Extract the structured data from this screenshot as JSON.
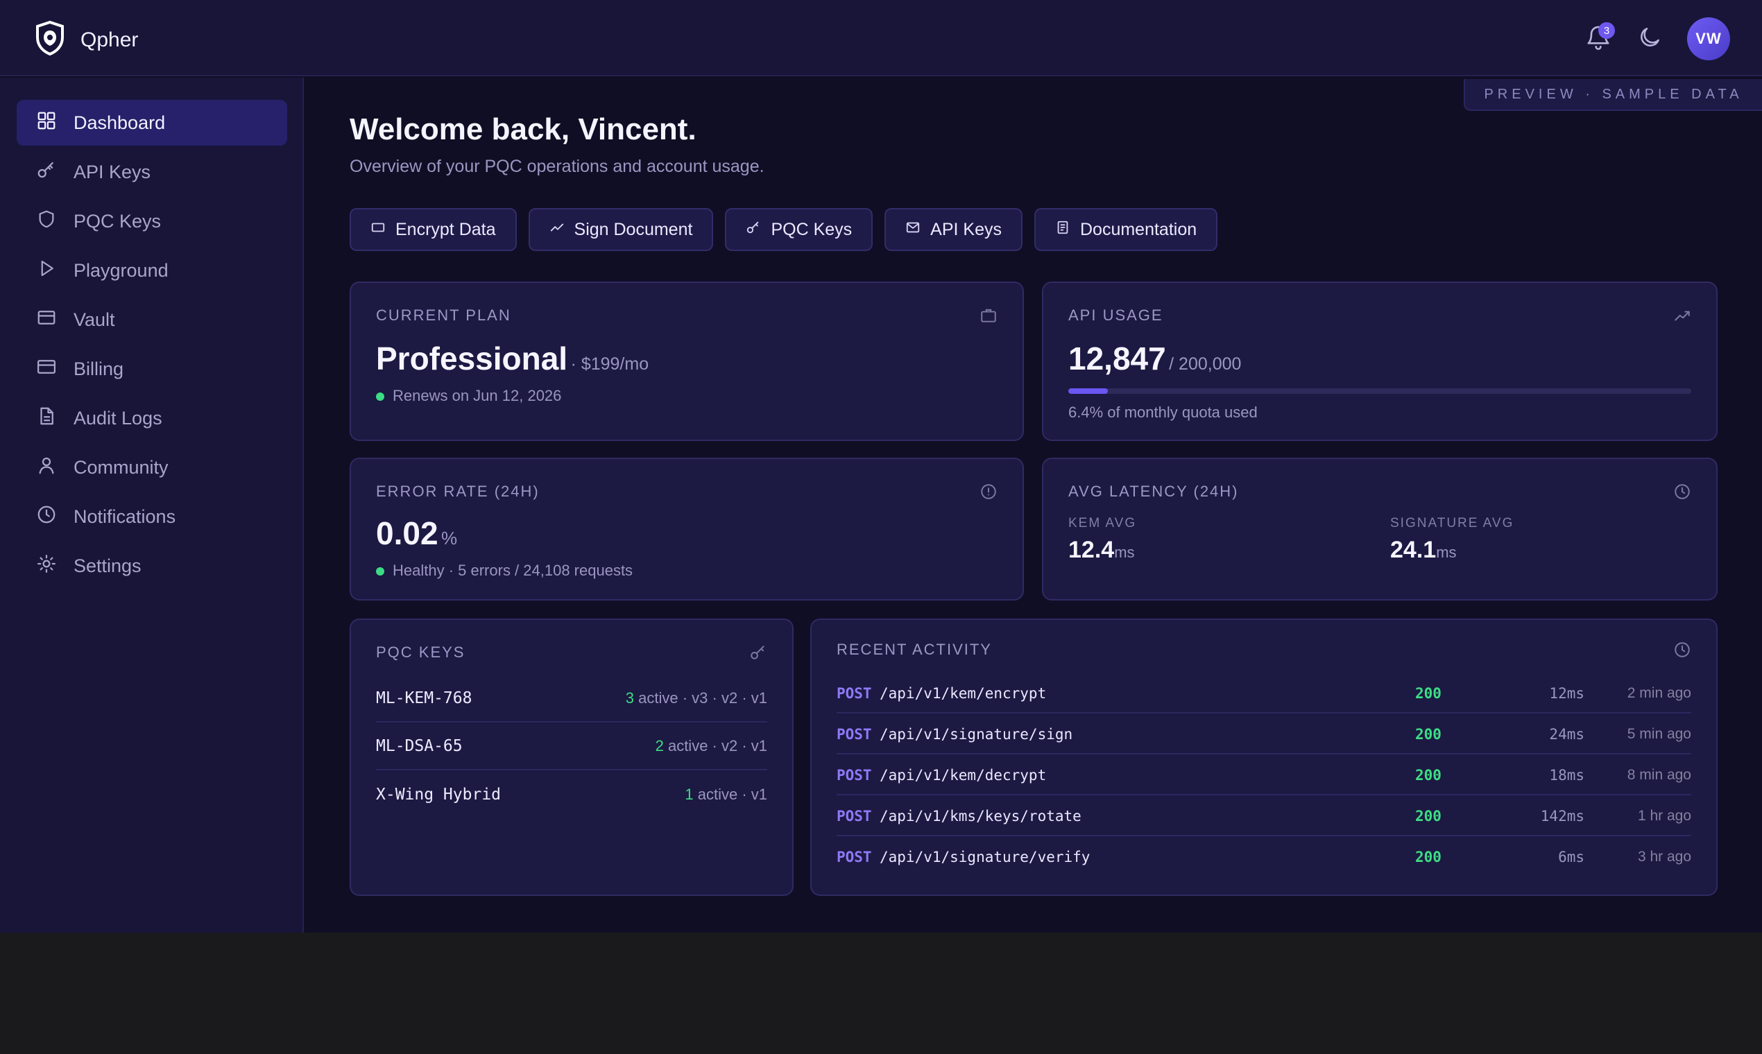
{
  "app": {
    "name": "Qpher"
  },
  "topbar": {
    "notification_count": "3",
    "avatar_initials": "VW"
  },
  "sidebar": {
    "items": [
      {
        "label": "Dashboard",
        "icon": "dashboard-icon",
        "active": true
      },
      {
        "label": "API Keys",
        "icon": "key-icon"
      },
      {
        "label": "PQC Keys",
        "icon": "shield-icon"
      },
      {
        "label": "Playground",
        "icon": "play-icon"
      },
      {
        "label": "Vault",
        "icon": "vault-icon"
      },
      {
        "label": "Billing",
        "icon": "credit-card-icon"
      },
      {
        "label": "Audit Logs",
        "icon": "document-icon"
      },
      {
        "label": "Community",
        "icon": "user-icon"
      },
      {
        "label": "Notifications",
        "icon": "clock-icon"
      },
      {
        "label": "Settings",
        "icon": "sun-gear-icon"
      }
    ]
  },
  "main": {
    "preview_badge": "PREVIEW · SAMPLE DATA",
    "welcome": "Welcome back, Vincent.",
    "subtitle": "Overview of your PQC operations and account usage.",
    "quick_actions": [
      {
        "label": "Encrypt Data",
        "icon": "box-icon"
      },
      {
        "label": "Sign Document",
        "icon": "signature-icon"
      },
      {
        "label": "PQC Keys",
        "icon": "key-icon"
      },
      {
        "label": "API Keys",
        "icon": "mail-icon"
      },
      {
        "label": "Documentation",
        "icon": "doc-icon"
      }
    ]
  },
  "plan": {
    "label": "CURRENT PLAN",
    "name": "Professional",
    "price": "· $199/mo",
    "renews": "Renews on Jun 12, 2026"
  },
  "usage": {
    "label": "API USAGE",
    "used": "12,847",
    "quota": "/ 200,000",
    "fraction": 0.064,
    "note": "6.4% of monthly quota used",
    "accent": "#6a56f2"
  },
  "errors": {
    "label": "ERROR RATE (24H)",
    "value": "0.02",
    "unit": "%",
    "status": "Healthy · 5 errors / 24,108 requests",
    "status_color": "#3ddc84"
  },
  "latency": {
    "label": "AVG LATENCY (24H)",
    "kem_label": "KEM AVG",
    "kem_value": "12.4",
    "kem_unit": "ms",
    "sig_label": "SIGNATURE AVG",
    "sig_value": "24.1",
    "sig_unit": "ms"
  },
  "pqc_keys": {
    "label": "PQC KEYS",
    "rows": [
      {
        "name": "ML-KEM-768",
        "count": "3",
        "meta": " active · v3 · v2 · v1"
      },
      {
        "name": "ML-DSA-65",
        "count": "2",
        "meta": " active · v2 · v1"
      },
      {
        "name": "X-Wing Hybrid",
        "count": "1",
        "meta": " active · v1"
      }
    ]
  },
  "activity": {
    "label": "RECENT ACTIVITY",
    "rows": [
      {
        "method": "POST",
        "path": "/api/v1/kem/encrypt",
        "status": "200",
        "time": "12ms",
        "ago": "2 min ago"
      },
      {
        "method": "POST",
        "path": "/api/v1/signature/sign",
        "status": "200",
        "time": "24ms",
        "ago": "5 min ago"
      },
      {
        "method": "POST",
        "path": "/api/v1/kem/decrypt",
        "status": "200",
        "time": "18ms",
        "ago": "8 min ago"
      },
      {
        "method": "POST",
        "path": "/api/v1/kms/keys/rotate",
        "status": "200",
        "time": "142ms",
        "ago": "1 hr ago"
      },
      {
        "method": "POST",
        "path": "/api/v1/signature/verify",
        "status": "200",
        "time": "6ms",
        "ago": "3 hr ago"
      }
    ]
  }
}
